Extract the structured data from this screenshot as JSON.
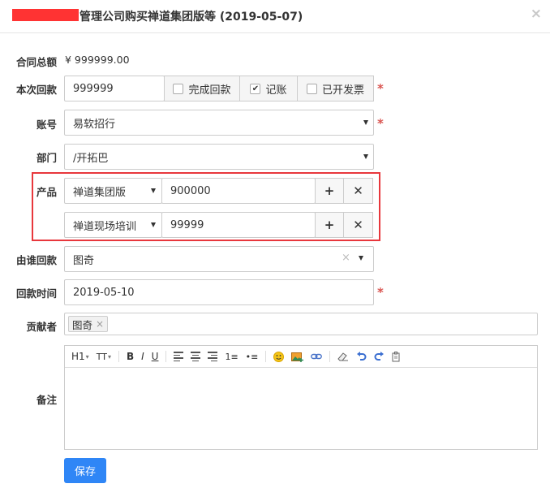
{
  "dialog": {
    "title": "管理公司购买禅道集团版等 (2019-05-07)",
    "close_glyph": "×"
  },
  "contract_total": {
    "label": "合同总额",
    "value": "¥ 999999.00"
  },
  "payment": {
    "label": "本次回款",
    "value": "999999",
    "options": [
      {
        "label": "完成回款",
        "checked": false
      },
      {
        "label": "记账",
        "checked": true
      },
      {
        "label": "已开发票",
        "checked": false
      }
    ]
  },
  "account": {
    "label": "账号",
    "value": "易软招行"
  },
  "department": {
    "label": "部门",
    "value": "/开拓巴"
  },
  "products": {
    "label": "产品",
    "rows": [
      {
        "product": "禅道集团版",
        "amount": "900000"
      },
      {
        "product": "禅道现场培训",
        "amount": "99999"
      }
    ]
  },
  "collector": {
    "label": "由谁回款",
    "value": "图奇"
  },
  "payment_time": {
    "label": "回款时间",
    "value": "2019-05-10"
  },
  "contributor": {
    "label": "贡献者",
    "tags": [
      "图奇"
    ]
  },
  "notes": {
    "label": "备注",
    "toolbar": {
      "heading": "H1",
      "font_size": "TT",
      "bold": "B",
      "italic": "I",
      "underline": "U"
    }
  },
  "save_label": "保存",
  "colors": {
    "required": "#d9534f",
    "highlight": "#e8373c",
    "primary": "#2f86f6"
  }
}
